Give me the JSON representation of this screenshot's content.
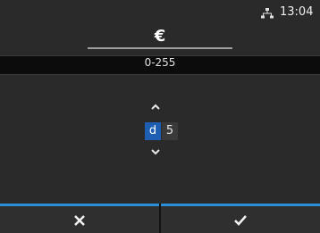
{
  "status": {
    "time": "13:04",
    "network_icon": "network-icon"
  },
  "header": {
    "symbol": "€"
  },
  "range": {
    "text": "0-255"
  },
  "editor": {
    "digits": [
      {
        "value": "d",
        "selected": true
      },
      {
        "value": "5",
        "selected": false
      }
    ],
    "up_icon": "chevron-up-icon",
    "down_icon": "chevron-down-icon"
  },
  "buttons": {
    "cancel_icon": "cancel-icon",
    "ok_icon": "checkmark-icon",
    "accent_color": "#2a8fd6"
  }
}
